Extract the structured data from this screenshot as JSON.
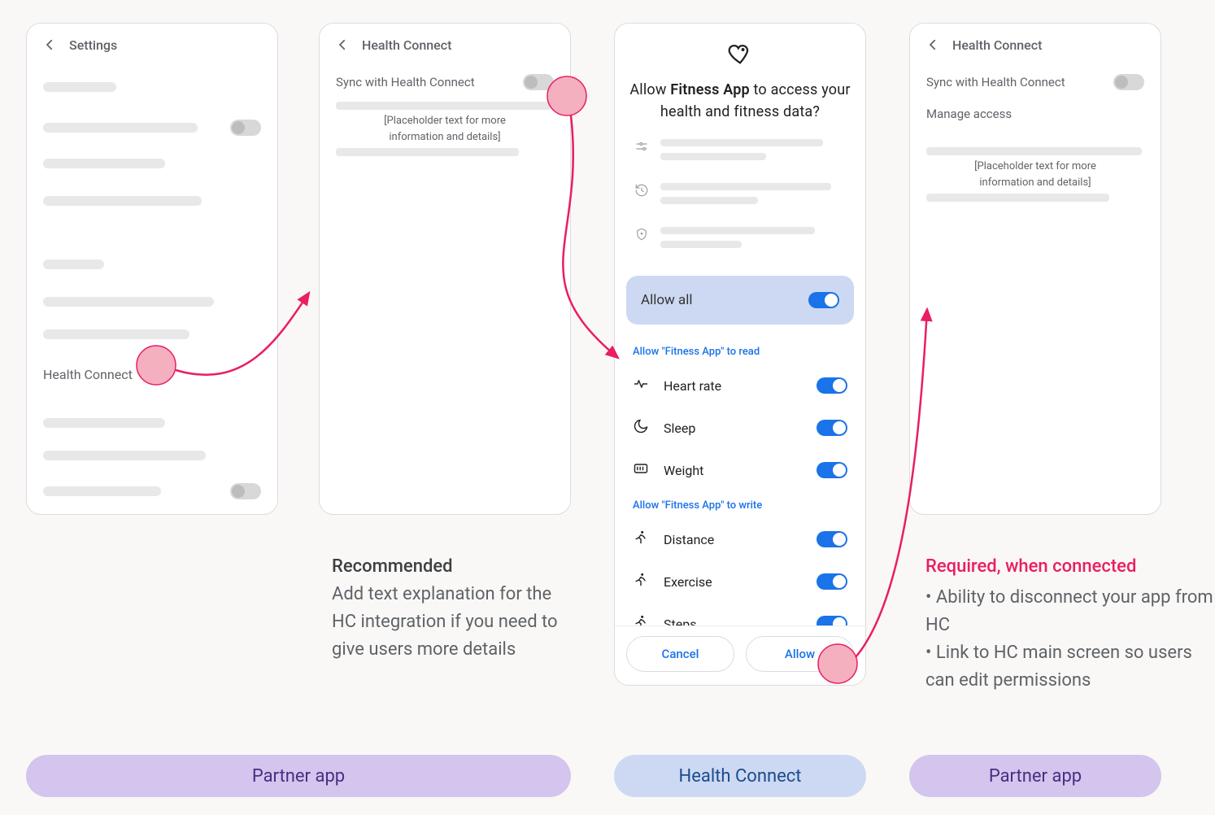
{
  "screen1": {
    "title": "Settings",
    "health_connect_label": "Health Connect"
  },
  "screen2": {
    "title": "Health Connect",
    "sync_label": "Sync with Health Connect",
    "placeholder_line1": "[Placeholder text for more",
    "placeholder_line2": "information and details]"
  },
  "screen3": {
    "prompt_pre": "Allow ",
    "prompt_app": "Fitness App",
    "prompt_post": " to access your health and fitness data?",
    "allow_all": "Allow all",
    "read_header": "Allow \"Fitness App\" to read",
    "write_header": "Allow \"Fitness App\" to write",
    "read": [
      {
        "icon": "heart",
        "label": "Heart rate"
      },
      {
        "icon": "sleep",
        "label": "Sleep"
      },
      {
        "icon": "weight",
        "label": "Weight"
      }
    ],
    "write": [
      {
        "icon": "run",
        "label": "Distance"
      },
      {
        "icon": "run",
        "label": "Exercise"
      },
      {
        "icon": "run",
        "label": "Steps"
      }
    ],
    "cancel": "Cancel",
    "allow": "Allow"
  },
  "screen4": {
    "title": "Health Connect",
    "sync_label": "Sync with Health Connect",
    "manage_label": "Manage access",
    "placeholder_line1": "[Placeholder text for more",
    "placeholder_line2": "information and details]"
  },
  "caption_recommended": {
    "title": "Recommended",
    "body": "Add text explanation for the HC integration if you need to give users more details"
  },
  "caption_required": {
    "title": "Required, when connected",
    "bullet1": "Ability to disconnect your app from HC",
    "bullet2": "Link to HC main screen so users can edit permissions"
  },
  "footers": {
    "partner": "Partner app",
    "hc": "Health Connect"
  }
}
